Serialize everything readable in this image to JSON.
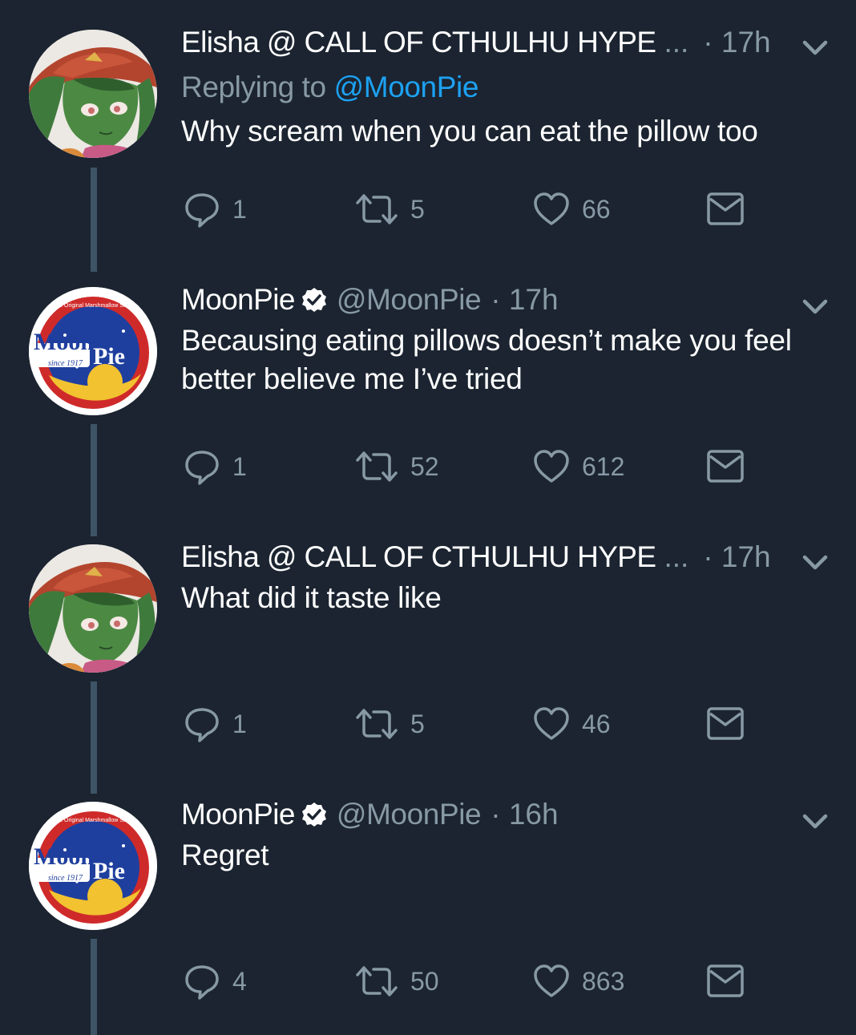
{
  "tweets": [
    {
      "name": "Elisha @ CALL OF CTHULHU HYPE",
      "ellipsis": "...",
      "time": "· 17h",
      "reply_prefix": "Replying to",
      "reply_mention": "@MoonPie",
      "text": "Why scream when you can eat the pillow too",
      "replies": "1",
      "retweets": "5",
      "likes": "66",
      "avatar": "witch-avatar"
    },
    {
      "name": "MoonPie",
      "handle": "@MoonPie",
      "time": "· 17h",
      "verified": true,
      "text": "Becausing eating pillows doesn’t make you feel better believe me I’ve tried",
      "replies": "1",
      "retweets": "52",
      "likes": "612",
      "avatar": "moonpie-logo"
    },
    {
      "name": "Elisha @ CALL OF CTHULHU HYPE",
      "ellipsis": "...",
      "time": "· 17h",
      "text": "What did it taste like",
      "replies": "1",
      "retweets": "5",
      "likes": "46",
      "avatar": "witch-avatar"
    },
    {
      "name": "MoonPie",
      "handle": "@MoonPie",
      "time": "· 16h",
      "verified": true,
      "text": "Regret",
      "replies": "4",
      "retweets": "50",
      "likes": "863",
      "avatar": "moonpie-logo"
    }
  ],
  "logo": {
    "top_text": "The Original Marshmallow Sandwich",
    "moon": "Moon",
    "pie": "Pie",
    "since": "since 1917"
  },
  "colors": {
    "background": "#1b2430",
    "muted": "#8899a6",
    "link": "#1da1f2",
    "thread_line": "#3d5466"
  },
  "icons": [
    "reply-icon",
    "retweet-icon",
    "like-icon",
    "dm-icon",
    "chevron-down-icon",
    "verified-icon"
  ]
}
